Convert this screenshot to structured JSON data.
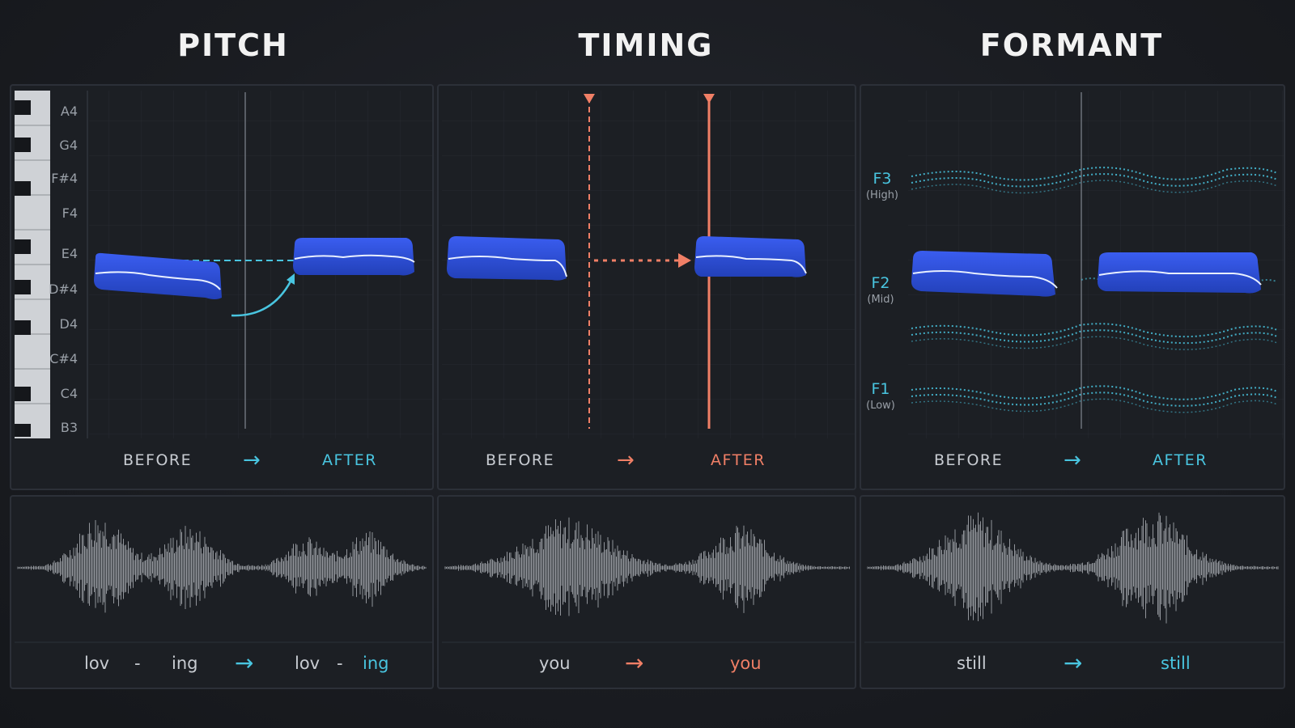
{
  "sections": {
    "pitch": {
      "title": "PITCH"
    },
    "timing": {
      "title": "TIMING"
    },
    "formant": {
      "title": "FORMANT"
    }
  },
  "pitch": {
    "notes": [
      "A4",
      "G4",
      "F#4",
      "F4",
      "E4",
      "D#4",
      "D4",
      "C#4",
      "C4",
      "B3"
    ],
    "before_label": "BEFORE",
    "after_label": "AFTER",
    "arrow": "→",
    "syllables_before": [
      "lov",
      "-",
      "ing"
    ],
    "syllables_after": [
      "lov",
      "-",
      "ing"
    ]
  },
  "timing": {
    "before_label": "BEFORE",
    "after_label": "AFTER",
    "arrow": "→",
    "word_before": "you",
    "word_after": "you"
  },
  "formant": {
    "bands": [
      {
        "label": "F3",
        "sub": "(High)"
      },
      {
        "label": "F2",
        "sub": "(Mid)"
      },
      {
        "label": "F1",
        "sub": "(Low)"
      }
    ],
    "before_label": "BEFORE",
    "after_label": "AFTER",
    "arrow": "→",
    "word_before": "still",
    "word_after": "still"
  },
  "colors": {
    "cyan": "#49c5e0",
    "salmon": "#f07f66",
    "blob": "#2f51d6",
    "text_dim": "#c8ccd2"
  }
}
